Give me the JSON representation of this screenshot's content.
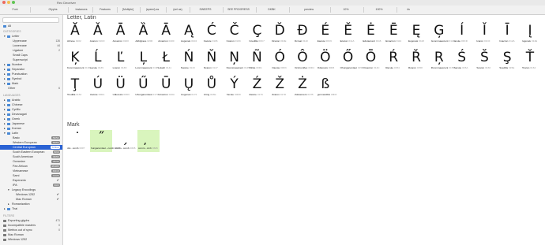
{
  "window": {
    "title": "Rec Deceiver"
  },
  "toolbar": {
    "items": [
      "Font",
      "Glyphs",
      "Instances",
      "Features",
      "[Multiple]",
      "(speed) as",
      "(sel as)",
      "SWEEPS",
      "SEE PROGRESS",
      "DKBK",
      "preview",
      "10%",
      "100%",
      "4s"
    ]
  },
  "sidebar": {
    "all": "All",
    "categories_header": "CATEGORIES",
    "languages_header": "LANGUAGES",
    "filters_header": "FILTERS",
    "categories": [
      {
        "label": "Letter",
        "count": ""
      },
      {
        "label": "Uppercase",
        "count": "126"
      },
      {
        "label": "Lowercase",
        "count": "44"
      },
      {
        "label": "Ligature",
        "count": "2"
      },
      {
        "label": "Small Caps",
        "count": ""
      },
      {
        "label": "Superscript",
        "count": ""
      },
      {
        "label": "Number",
        "count": ""
      },
      {
        "label": "Separator",
        "count": ""
      },
      {
        "label": "Punctuation",
        "count": ""
      },
      {
        "label": "Symbol",
        "count": ""
      },
      {
        "label": "Mark",
        "count": ""
      },
      {
        "label": "Other",
        "count": "6"
      }
    ],
    "languages": [
      {
        "label": "Arabic",
        "badge": ""
      },
      {
        "label": "Chinese",
        "badge": ""
      },
      {
        "label": "Cyrillic",
        "badge": ""
      },
      {
        "label": "Devanagari",
        "badge": ""
      },
      {
        "label": "Greek",
        "badge": ""
      },
      {
        "label": "Japanese",
        "badge": ""
      },
      {
        "label": "Korean",
        "badge": ""
      },
      {
        "label": "Latin",
        "badge": ""
      },
      {
        "label": "Basic",
        "badge": "52/52"
      },
      {
        "label": "Western European",
        "badge": "60/64"
      },
      {
        "label": "Central European",
        "badge": "77/214"
      },
      {
        "label": "South Eastern European",
        "badge": "8/16"
      },
      {
        "label": "South American",
        "badge": "30/66"
      },
      {
        "label": "Oceanian",
        "badge": "26/36"
      },
      {
        "label": "Pan African",
        "badge": "45/185"
      },
      {
        "label": "Vietnamese",
        "badge": "8/218"
      },
      {
        "label": "Sami",
        "badge": "13/26"
      },
      {
        "label": "Esperanto",
        "badge": "12/12"
      },
      {
        "label": "IPA",
        "badge": "0/22"
      },
      {
        "label": "Legacy Encodings",
        "badge": ""
      },
      {
        "label": "Windows 1252",
        "badge": ""
      },
      {
        "label": "Mac Roman",
        "badge": ""
      },
      {
        "label": "Romanization",
        "badge": ""
      },
      {
        "label": "Thai",
        "badge": ""
      }
    ],
    "filters": [
      {
        "label": "Exporting glyphs",
        "count": "471"
      },
      {
        "label": "Incompatible masters",
        "count": "0"
      },
      {
        "label": "Metrics out of sync",
        "count": "0"
      },
      {
        "label": "Mac Roman",
        "count": ""
      },
      {
        "label": "Windows 1252",
        "count": ""
      }
    ]
  },
  "main": {
    "section_letter": "Letter, Latin",
    "section_mark": "Mark",
    "letter_glyphs": [
      {
        "char": "Ă",
        "name": "Abreve",
        "code": "0102"
      },
      {
        "char": "Ǎ",
        "name": "Acaron",
        "code": "01CD"
      },
      {
        "char": "Ā",
        "name": "Amacron",
        "code": "0100"
      },
      {
        "char": "Ȁ",
        "name": "Adblgrave",
        "code": "0200"
      },
      {
        "char": "Ā",
        "name": "Amacron",
        "code": "0100"
      },
      {
        "char": "Ą",
        "name": "Aogonek",
        "code": "0104"
      },
      {
        "char": "Ć",
        "name": "Cacute",
        "code": "0106"
      },
      {
        "char": "Č",
        "name": "Ccaron",
        "code": "010C"
      },
      {
        "char": "Ç",
        "name": "Ccedilla",
        "code": "00C7"
      },
      {
        "char": "Ď",
        "name": "Dcaron",
        "code": "010E"
      },
      {
        "char": "Đ",
        "name": "Dcroat",
        "code": "0110"
      },
      {
        "char": "É",
        "name": "Eacute",
        "code": "00C9"
      },
      {
        "char": "Ě",
        "name": "Ecaron",
        "code": "011A"
      },
      {
        "char": "Ė",
        "name": "Edotaccent",
        "code": "0116"
      },
      {
        "char": "Ē",
        "name": "Emacron",
        "code": "0112"
      },
      {
        "char": "Ę",
        "name": "Eogonek",
        "code": "0118"
      },
      {
        "char": "Ģ",
        "name": "Gcommaaccent",
        "code": "0122"
      },
      {
        "char": "Í",
        "name": "Iacute",
        "code": "00CD"
      },
      {
        "char": "Ǐ",
        "name": "Icaron",
        "code": "01CF"
      },
      {
        "char": "Ī",
        "name": "Imacron",
        "code": "012A"
      },
      {
        "char": "Į",
        "name": "Iogonek",
        "code": "012E"
      },
      {
        "char": "Ķ",
        "name": "Kcommaaccent",
        "code": "0136"
      },
      {
        "char": "Ĺ",
        "name": "Lacute",
        "code": "0139"
      },
      {
        "char": "Ľ",
        "name": "Lcaron",
        "code": "013D"
      },
      {
        "char": "Ļ",
        "name": "Lcommaaccent",
        "code": "013B"
      },
      {
        "char": "Ł",
        "name": "Lslash",
        "code": "0141"
      },
      {
        "char": "Ń",
        "name": "Nacute",
        "code": "0143"
      },
      {
        "char": "Ň",
        "name": "Ncaron",
        "code": "0147"
      },
      {
        "char": "Ņ",
        "name": "Ncommaaccent",
        "code": "0145"
      },
      {
        "char": "Ñ",
        "name": "Ntilde",
        "code": "00D1"
      },
      {
        "char": "Ó",
        "name": "Oacute",
        "code": "00D3"
      },
      {
        "char": "Ô",
        "name": "Ocircumflex",
        "code": "00D4"
      },
      {
        "char": "Ö",
        "name": "Odieresis",
        "code": "00D6"
      },
      {
        "char": "Ő",
        "name": "Ohungarumlaut",
        "code": "0150"
      },
      {
        "char": "Ō",
        "name": "Omacron",
        "code": "014C"
      },
      {
        "char": "Ŕ",
        "name": "Racute",
        "code": "0154"
      },
      {
        "char": "Ř",
        "name": "Rcaron",
        "code": "0158"
      },
      {
        "char": "Ŗ",
        "name": "Rcommaaccent",
        "code": "0156"
      },
      {
        "char": "Ś",
        "name": "Sacute",
        "code": "015A"
      },
      {
        "char": "Š",
        "name": "Scaron",
        "code": "0160"
      },
      {
        "char": "Ş",
        "name": "Scedilla",
        "code": "015E"
      },
      {
        "char": "Ť",
        "name": "Tcaron",
        "code": "0164"
      },
      {
        "char": "Ţ",
        "name": "Tcedilla",
        "code": "0162"
      },
      {
        "char": "Ú",
        "name": "Uacute",
        "code": "00DA"
      },
      {
        "char": "Ü",
        "name": "Udieresis",
        "code": "00DC"
      },
      {
        "char": "Ű",
        "name": "Uhungarumlaut",
        "code": "0170"
      },
      {
        "char": "Ū",
        "name": "Umacron",
        "code": "016A"
      },
      {
        "char": "Ų",
        "name": "Uogonek",
        "code": "0172"
      },
      {
        "char": "Ů",
        "name": "Uring",
        "code": "016E"
      },
      {
        "char": "Ý",
        "name": "Yacute",
        "code": "00DD"
      },
      {
        "char": "Ź",
        "name": "Zacute",
        "code": "0179"
      },
      {
        "char": "Ž",
        "name": "Zcaron",
        "code": "017D"
      },
      {
        "char": "Ż",
        "name": "Zdotaccent",
        "code": "017B"
      },
      {
        "char": "ß",
        "name": "germandbls",
        "code": "00DF"
      }
    ],
    "mark_glyphs": [
      {
        "char": "˙",
        "name": "dot...comb",
        "code": "0307",
        "highlight": false
      },
      {
        "char": "˝",
        "name": "hungarumlaut...comb",
        "code": "030B",
        "highlight": true
      },
      {
        "char": "ˏ",
        "name": "comm...comb",
        "code": "0326",
        "highlight": false
      },
      {
        "char": "̦",
        "name": "comm...cmb",
        "code": "0326",
        "highlight": true
      }
    ]
  }
}
